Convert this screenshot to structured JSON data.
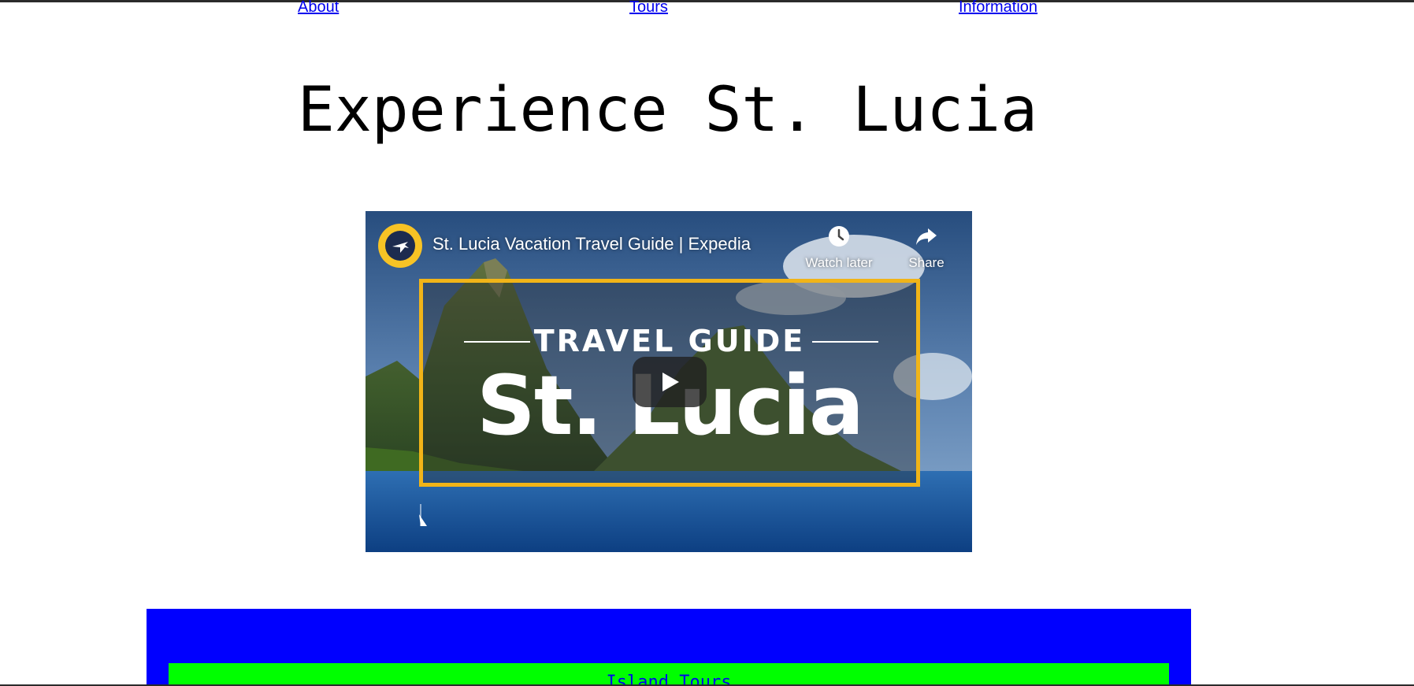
{
  "nav": {
    "about": "About",
    "tours": "Tours",
    "information": "Information"
  },
  "page": {
    "title": "Experience St. Lucia"
  },
  "video": {
    "title": "St. Lucia Vacation Travel Guide | Expedia",
    "watch_later": "Watch later",
    "share": "Share",
    "thumbnail_heading": "TRAVEL GUIDE",
    "thumbnail_place": "St. Lucia"
  },
  "section": {
    "green_label": "Island Tours"
  },
  "colors": {
    "link": "#0000ee",
    "section_bg": "#0000ff",
    "card_bg": "#00ff00",
    "frame_accent": "#f1b418",
    "channel_logo": "#f7c325"
  },
  "icons": {
    "channel": "expedia-plane-icon",
    "watch_later": "clock-icon",
    "share": "share-arrow-icon",
    "play": "play-icon"
  }
}
